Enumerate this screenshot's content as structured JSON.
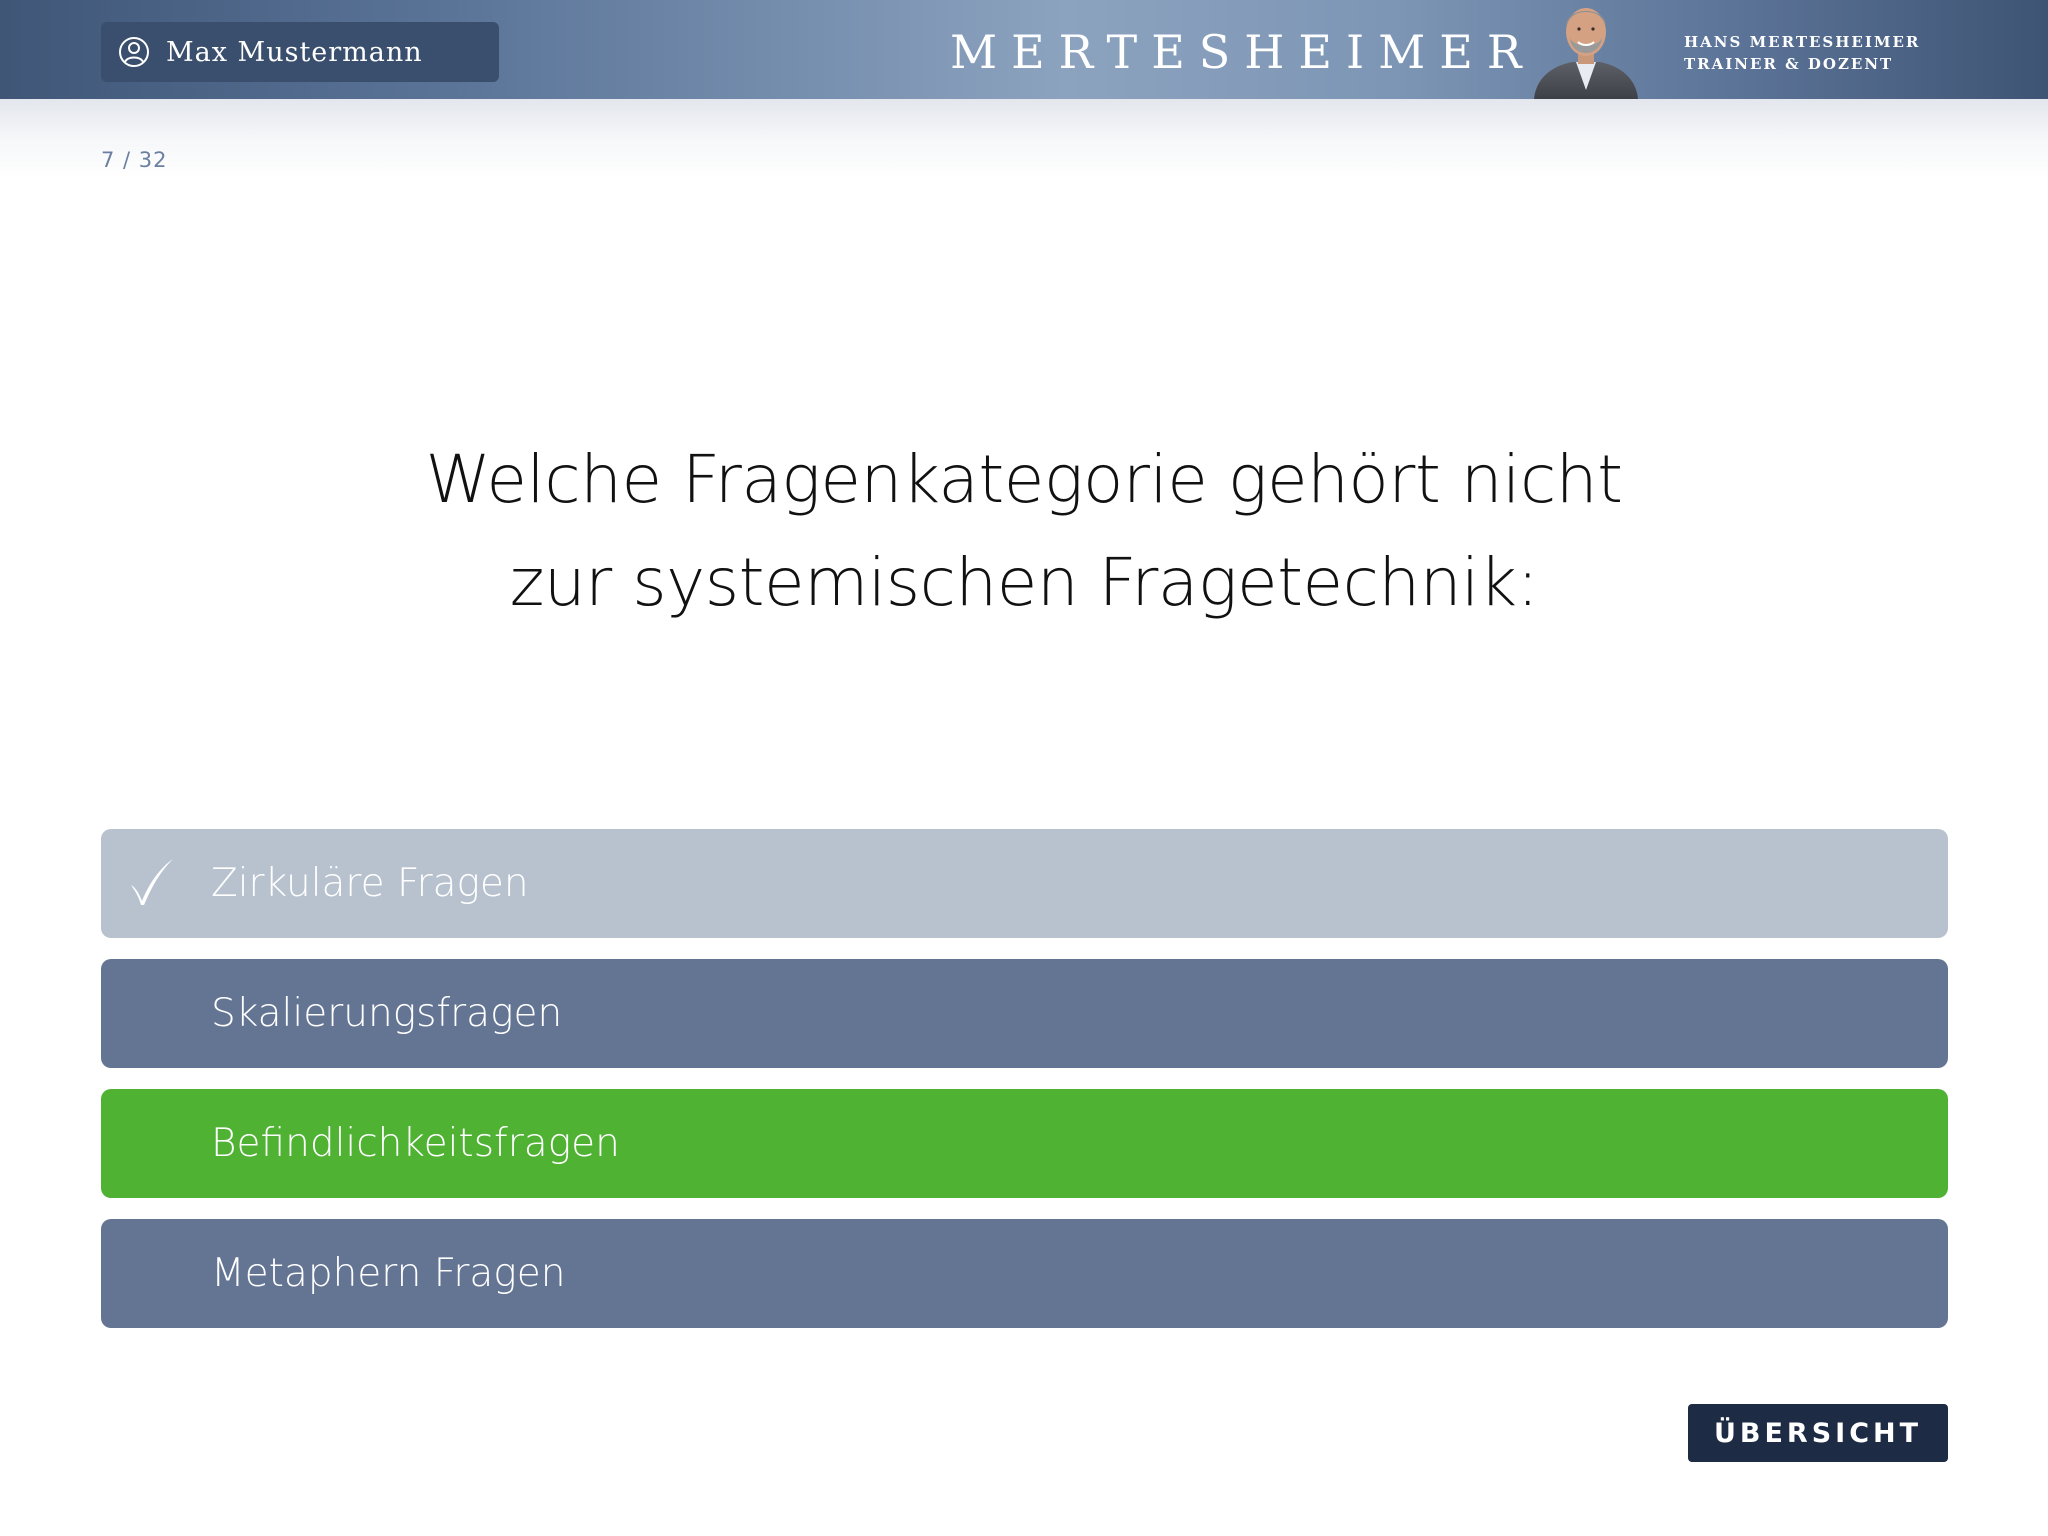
{
  "header": {
    "user_name": "Max Mustermann",
    "user_icon": "user-circle-icon",
    "brand": "MERTESHEIMER",
    "trainer_name": "HANS MERTESHEIMER",
    "trainer_role": "TRAINER & DOZENT"
  },
  "progress": "7 / 32",
  "question": {
    "line1": "Welche Fragenkategorie gehört nicht",
    "line2": "zur systemischen Fragetechnik:"
  },
  "answers": [
    {
      "label": "Zirkuläre Fragen",
      "state": "selected",
      "color": "#b8c2cf",
      "checked": true
    },
    {
      "label": "Skalierungsfragen",
      "state": "default",
      "color": "#647594",
      "checked": false
    },
    {
      "label": "Befindlichkeitsfragen",
      "state": "correct",
      "color": "#4fb233",
      "checked": false
    },
    {
      "label": "Metaphern Fragen",
      "state": "default",
      "color": "#647594",
      "checked": false
    }
  ],
  "overview_button": "ÜBERSICHT",
  "colors": {
    "header_dark": "#3f5677",
    "header_light": "#8ca3bf",
    "user_box": "#3a4f6d",
    "button_dark": "#1e2b45",
    "progress_text": "#6b7fa0"
  }
}
